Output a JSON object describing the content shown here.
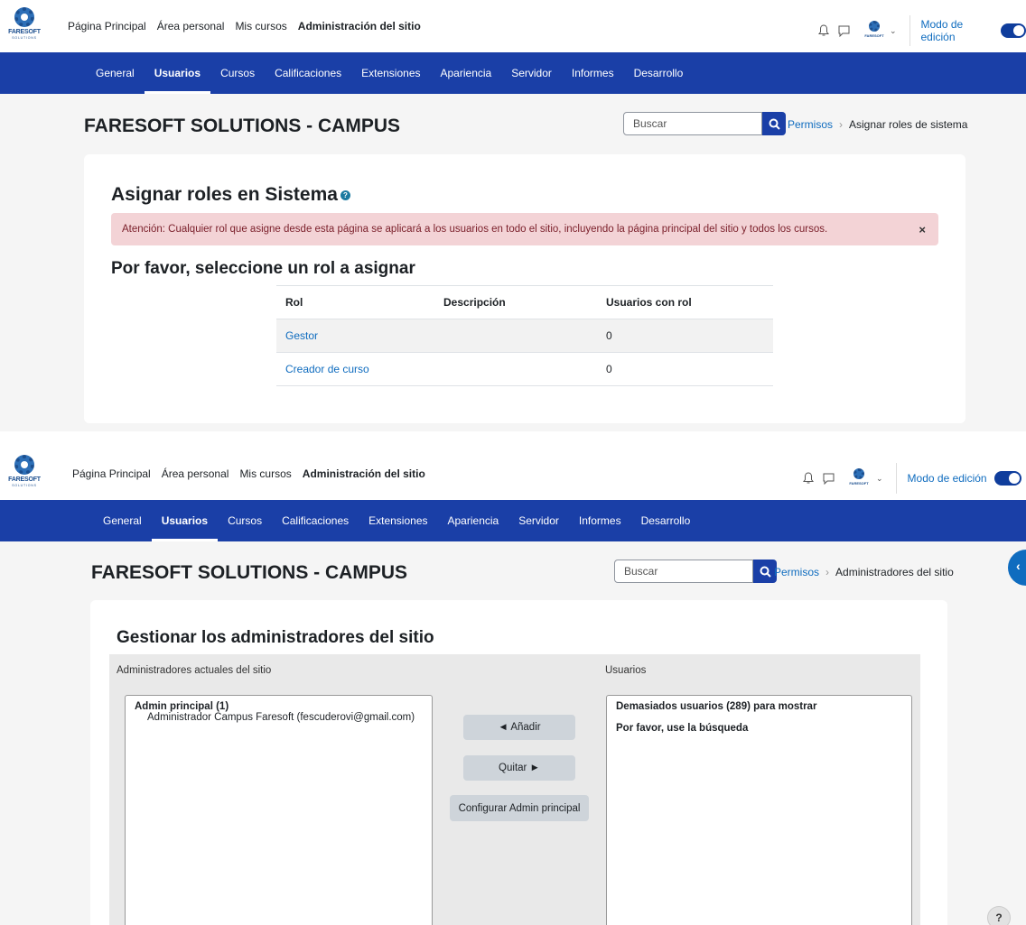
{
  "shot1": {
    "logo": {
      "brand": "FARESOFT",
      "sub": "SOLUTIONS"
    },
    "top_nav": [
      "Página Principal",
      "Área personal",
      "Mis cursos",
      "Administración del sitio"
    ],
    "top_nav_active": "Administración del sitio",
    "avatar_text": "FARESOFT",
    "edit_mode_label": "Modo de edición",
    "tabs": [
      "General",
      "Usuarios",
      "Cursos",
      "Calificaciones",
      "Extensiones",
      "Apariencia",
      "Servidor",
      "Informes",
      "Desarrollo"
    ],
    "active_tab": "Usuarios",
    "site_title": "FARESOFT SOLUTIONS - CAMPUS",
    "search_placeholder": "Buscar",
    "breadcrumb": {
      "link": "Permisos",
      "current": "Asignar roles de sistema"
    },
    "page_title": "Asignar roles en Sistema",
    "help_glyph": "?",
    "alert": {
      "text": "Atención: Cualquier rol que asigne desde esta página se aplicará a los usuarios en todo el sitio, incluyendo la página principal del sitio y todos los cursos.",
      "close": "×"
    },
    "subtitle": "Por favor, seleccione un rol a asignar",
    "table": {
      "headers": [
        "Rol",
        "Descripción",
        "Usuarios con rol"
      ],
      "rows": [
        {
          "rol": "Gestor",
          "descripcion": "",
          "usuarios": "0"
        },
        {
          "rol": "Creador de curso",
          "descripcion": "",
          "usuarios": "0"
        }
      ]
    }
  },
  "shot2": {
    "logo": {
      "brand": "FARESOFT",
      "sub": "SOLUTIONS"
    },
    "top_nav": [
      "Página Principal",
      "Área personal",
      "Mis cursos",
      "Administración del sitio"
    ],
    "avatar_text": "FARESOFT",
    "edit_mode_label": "Modo de edición",
    "tabs": [
      "General",
      "Usuarios",
      "Cursos",
      "Calificaciones",
      "Extensiones",
      "Apariencia",
      "Servidor",
      "Informes",
      "Desarrollo"
    ],
    "site_title": "FARESOFT SOLUTIONS - CAMPUS",
    "search_placeholder": "Buscar",
    "breadcrumb": {
      "link": "Permisos",
      "current": "Administradores del sitio"
    },
    "page_title": "Gestionar los administradores del sitio",
    "left_label": "Administradores actuales del sitio",
    "right_label": "Usuarios",
    "left_list": {
      "group": "Admin principal (1)",
      "option": "Administrador Campus Faresoft (fescuderovi@gmail.com)"
    },
    "right_list": {
      "group": "Demasiados usuarios (289) para mostrar",
      "hint": "Por favor, use la búsqueda"
    },
    "buttons": {
      "add": "◄ Añadir",
      "remove": "Quitar ►",
      "set_main": "Configurar Admin principal"
    },
    "drawer_glyph": "‹",
    "help_button": "?"
  },
  "colors": {
    "nav_blue": "#1a3fa7",
    "link_blue": "#0f6cbf",
    "alert_bg": "#f3d3d6",
    "alert_text": "#7a1f2a"
  }
}
